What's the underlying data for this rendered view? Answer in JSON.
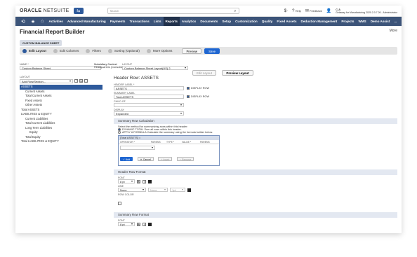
{
  "topbar": {
    "logo_main": "ORACLE",
    "logo_sub": "NETSUITE",
    "search_placeholder": "Search",
    "help": "Help",
    "feedback": "Feedback",
    "user_initials": "C.A",
    "user_context": "Getaway for Manufacturing 2020.2.0.7.26 - Administrator"
  },
  "nav": {
    "items": [
      "Activities",
      "Advanced Manufacturing",
      "Payments",
      "Transactions",
      "Lists",
      "Reports",
      "Analytics",
      "Documents",
      "Setup",
      "Customization",
      "Quality",
      "Fixed Assets",
      "Deduction Management",
      "Projects",
      "WMS",
      "Demo Assist"
    ],
    "active": "Reports",
    "overflow": "..."
  },
  "header": {
    "title": "Financial Report Builder",
    "subtitle": "CUSTOM BALANCE SHEET",
    "more": "More"
  },
  "steps": {
    "items": [
      "Edit Layout",
      "Edit Columns",
      "Filters",
      "Sorting (Optional)",
      "More Options"
    ],
    "preview": "Preview",
    "save": "Save"
  },
  "meta": {
    "name_label": "NAME *",
    "name_value": "Custom Balance Sheet",
    "subsidiary_label": "Subsidiary Context",
    "subsidiary_value": "Headquarters (Consolidated)",
    "layout_label": "LAYOUT",
    "layout_value": "Custom Balance Sheet Layout(US) 2",
    "edit_layout": "Edit Layout",
    "preview_layout": "Preview Layout"
  },
  "tree": {
    "label": "LAYOUT",
    "add_placeholder": "Add Row/Section...",
    "items": [
      {
        "label": "ASSETS",
        "selected": true,
        "indent": 0
      },
      {
        "label": "Current Assets",
        "indent": 1
      },
      {
        "label": "Total Current Assets",
        "indent": 1
      },
      {
        "label": "Fixed Assets",
        "indent": 1
      },
      {
        "label": "Other Assets",
        "indent": 1
      },
      {
        "label": "Total ASSETS",
        "indent": 0
      },
      {
        "label": "LIABILITIES & EQUITY",
        "indent": 0
      },
      {
        "label": "Current Liabilities",
        "indent": 1
      },
      {
        "label": "Total Current Liabilities",
        "indent": 1
      },
      {
        "label": "Long Term Liabilities",
        "indent": 1
      },
      {
        "label": "Equity",
        "indent": 2
      },
      {
        "label": "Total Equity",
        "indent": 1
      },
      {
        "label": "Total LIABILITIES & EQUITY",
        "indent": 0
      }
    ]
  },
  "editor": {
    "title": "Header Row: ASSETS",
    "header_label_label": "HEADER LABEL *",
    "header_label_value": "ASSETS",
    "display_row": "DISPLAY ROW",
    "summary_label_label": "SUMMARY LABEL",
    "summary_label_value": "Total ASSETS",
    "child_of_label": "CHILD OF",
    "display_label": "DISPLAY",
    "display_value": "Expanded",
    "summary_calc_title": "Summary Row Calculation",
    "summary_method_text": "Select the method for summarizing rows within this header:",
    "dynamic_total": "DYNAMIC TOTAL",
    "dynamic_total_desc": "Sum all rows within this header.",
    "apply_formula": "APPLY A FORMULA",
    "apply_formula_desc": "Calculate the summary using the formula builder below.",
    "formula_head": "[Total ASSETS] =",
    "formula_cols": [
      "OPERATOR *",
      "PARENS",
      "TYPE *",
      "VALUE *",
      "PARENS"
    ],
    "add_btn": "Add",
    "cancel_btn": "Cancel",
    "insert_btn": "Insert",
    "remove_btn": "Remove",
    "header_format_title": "Header Row Format",
    "font_label": "FONT",
    "font_value": "8 pt",
    "line_label": "LINE",
    "line_value": "None",
    "line_mid": "None",
    "line_right": "1pt",
    "row_color_label": "ROW COLOR",
    "summary_format_title": "Summary Row Format",
    "summary_font_label": "FONT",
    "summary_font_value": "8 pt"
  }
}
